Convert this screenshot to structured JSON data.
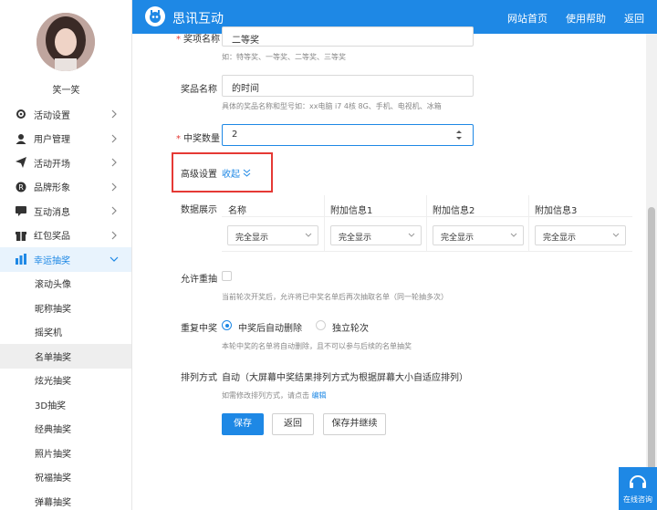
{
  "brand": {
    "name": "思讯互动",
    "accent": "#1e88e5"
  },
  "topnav": [
    "网站首页",
    "使用帮助",
    "返回"
  ],
  "user": {
    "name": "笑一笑"
  },
  "menu": [
    {
      "label": "活动设置",
      "icon": "gear-icon"
    },
    {
      "label": "用户管理",
      "icon": "user-icon"
    },
    {
      "label": "活动开场",
      "icon": "send-icon"
    },
    {
      "label": "品牌形象",
      "icon": "registered-icon"
    },
    {
      "label": "互动消息",
      "icon": "message-icon"
    },
    {
      "label": "红包奖品",
      "icon": "gift-icon"
    },
    {
      "label": "幸运抽奖",
      "icon": "chart-icon"
    }
  ],
  "submenu": [
    "滚动头像",
    "昵称抽奖",
    "摇奖机",
    "名单抽奖",
    "炫光抽奖",
    "3D抽奖",
    "经典抽奖",
    "照片抽奖",
    "祝福抽奖",
    "弹幕抽奖"
  ],
  "form": {
    "prize_level": {
      "label": "奖项名称",
      "value": "二等奖",
      "hint": "如：特等奖、一等奖、二等奖、三等奖"
    },
    "prize_name": {
      "label": "奖品名称",
      "value": "的时间",
      "hint": "具体的奖品名称和型号如：xx电脑 i7 4核 8G、手机、电视机、冰箱"
    },
    "win_count": {
      "label": "中奖数量",
      "value": "2"
    },
    "advanced": {
      "label": "高级设置",
      "toggle": "收起"
    },
    "data_display": {
      "label": "数据展示",
      "columns": [
        "名称",
        "附加信息1",
        "附加信息2",
        "附加信息3"
      ],
      "values": [
        "完全显示",
        "完全显示",
        "完全显示",
        "完全显示"
      ]
    },
    "allow_repeat": {
      "label": "允许重抽",
      "hint": "当前轮次开奖后，允许将已中奖名单后再次抽取名单（同一轮抽多次）"
    },
    "repeat_win": {
      "label": "重复中奖",
      "option1": "中奖后自动删除",
      "option2": "独立轮次",
      "hint": "本轮中奖的名单将自动删除，且不可以参与后续的名单抽奖"
    },
    "sort": {
      "label": "排列方式",
      "value": "自动（大屏幕中奖结果排列方式为根据屏幕大小自适应排列）",
      "hint": "如需修改排列方式，请点击",
      "link": "编辑"
    }
  },
  "buttons": {
    "save": "保存",
    "back": "返回",
    "save_continue": "保存并继续"
  },
  "online": {
    "label": "在线咨询"
  }
}
